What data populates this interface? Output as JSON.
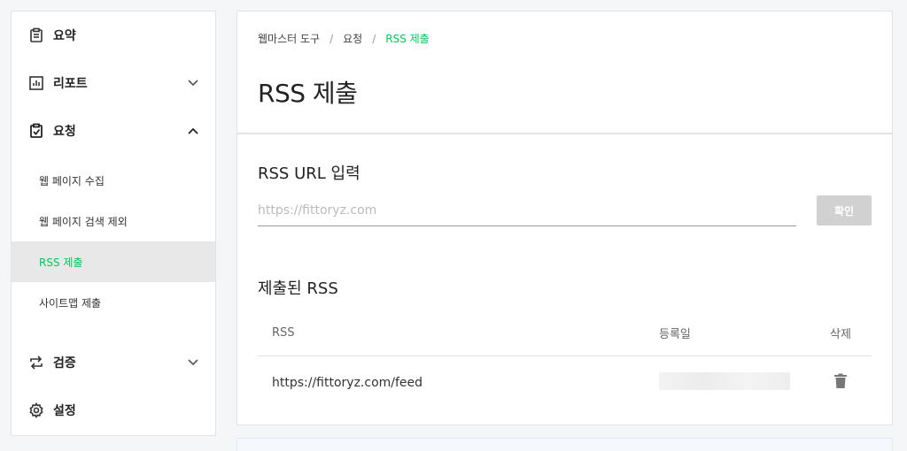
{
  "sidebar": {
    "menu": [
      {
        "label": "요약",
        "icon": "clipboard-list-icon",
        "chevron": ""
      },
      {
        "label": "리포트",
        "icon": "bar-chart-icon",
        "chevron": "down"
      },
      {
        "label": "요청",
        "icon": "clipboard-check-icon",
        "chevron": "up"
      }
    ],
    "sub_items": [
      "웹 페이지 수집",
      "웹 페이지 검색 제외",
      "RSS 제출",
      "사이트맵 제출"
    ],
    "menu_bottom": [
      {
        "label": "검증",
        "icon": "repeat-arrows-icon",
        "chevron": "down"
      },
      {
        "label": "설정",
        "icon": "gear-icon",
        "chevron": ""
      }
    ]
  },
  "main": {
    "breadcrumb": [
      "웹마스터 도구",
      "요청",
      "RSS 제출"
    ],
    "page_title": "RSS 제출",
    "rss_input": {
      "title": "RSS URL 입력",
      "placeholder": "https://fittoryz.com",
      "value": "",
      "button": "확인"
    },
    "submitted": {
      "title": "제출된 RSS",
      "columns": [
        "RSS",
        "등록일",
        "삭제"
      ],
      "rows": [
        {
          "rss": "https://fittoryz.com/feed",
          "date": ""
        }
      ]
    }
  },
  "colors": {
    "accent": "#03c75a",
    "button_disabled": "#d1d1d1"
  }
}
